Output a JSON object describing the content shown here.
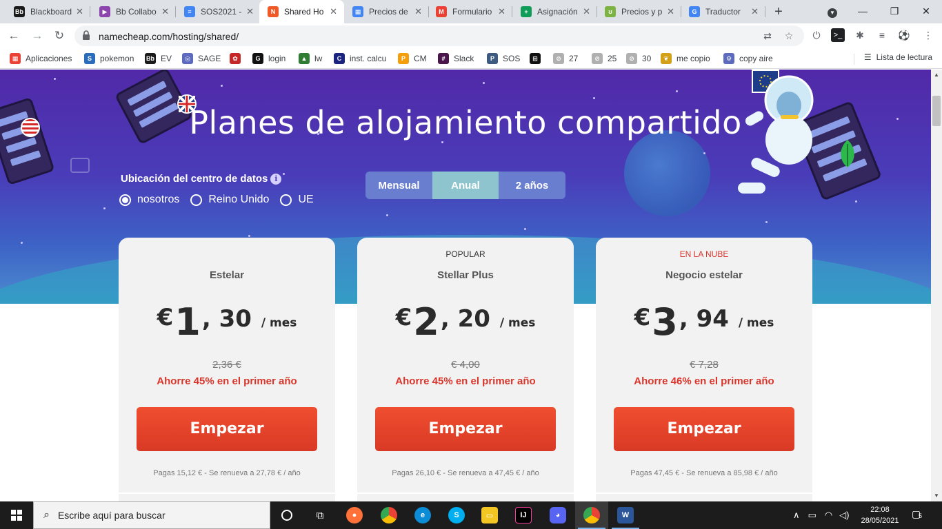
{
  "browser": {
    "tabs": [
      {
        "label": "Blackboard",
        "icon": "Bb",
        "color": "#1a1a1a"
      },
      {
        "label": "Bb Collabo",
        "icon": "▶",
        "color": "#8e44ad"
      },
      {
        "label": "SOS2021 -",
        "icon": "≡",
        "color": "#4285f4"
      },
      {
        "label": "Shared Ho",
        "icon": "N",
        "color": "#f05a28"
      },
      {
        "label": "Precios de",
        "icon": "▦",
        "color": "#4285f4"
      },
      {
        "label": "Formulario",
        "icon": "M",
        "color": "#ea4335"
      },
      {
        "label": "Asignación",
        "icon": "+",
        "color": "#0f9d58"
      },
      {
        "label": "Precios y p",
        "icon": "ʊ",
        "color": "#7cb342"
      },
      {
        "label": "Traductor",
        "icon": "G",
        "color": "#4285f4"
      }
    ],
    "active_tab": 3,
    "url": "namecheap.com/hosting/shared/",
    "bookmarks": [
      {
        "label": "Aplicaciones",
        "icon": "▦",
        "color": "#ea4335"
      },
      {
        "label": "pokemon",
        "icon": "S",
        "color": "#2a6ebb"
      },
      {
        "label": "EV",
        "icon": "Bb",
        "color": "#1a1a1a"
      },
      {
        "label": "SAGE",
        "icon": "◎",
        "color": "#5c6bc0"
      },
      {
        "label": "",
        "icon": "✿",
        "color": "#c62828"
      },
      {
        "label": "login",
        "icon": "G",
        "color": "#111"
      },
      {
        "label": "lw",
        "icon": "▲",
        "color": "#2e7d32"
      },
      {
        "label": "inst. calcu",
        "icon": "C",
        "color": "#1a237e"
      },
      {
        "label": "CM",
        "icon": "P",
        "color": "#f59e0b"
      },
      {
        "label": "Slack",
        "icon": "#",
        "color": "#4a154b"
      },
      {
        "label": "SOS",
        "icon": "P",
        "color": "#3d5a80"
      },
      {
        "label": "",
        "icon": "⊞",
        "color": "#111"
      },
      {
        "label": "27",
        "icon": "⊘",
        "color": "#b0b0b0"
      },
      {
        "label": "25",
        "icon": "⊘",
        "color": "#b0b0b0"
      },
      {
        "label": "30",
        "icon": "⊘",
        "color": "#b0b0b0"
      },
      {
        "label": "me copio",
        "icon": "❦",
        "color": "#d4a017"
      },
      {
        "label": "copy aire",
        "icon": "⚙",
        "color": "#5c6bc0"
      }
    ],
    "reading_list": "Lista de lectura"
  },
  "hero": {
    "title": "Planes de alojamiento compartido",
    "datacenter_label": "Ubicación del centro de datos",
    "info_icon": "i",
    "locations": [
      "nosotros",
      "Reino Unido",
      "UE"
    ],
    "selected_location": 0,
    "billing_options": [
      "Mensual",
      "Anual",
      "2 años"
    ],
    "selected_billing": 1
  },
  "plans": [
    {
      "badge": "",
      "name": "Estelar",
      "currency": "€",
      "int": "1",
      "dec": ", 30",
      "per": "/ mes",
      "old_price": "2,36 €",
      "save": "Ahorre 45% en el primer año",
      "cta": "Empezar",
      "renew": "Pagas 15,12 € - Se renueva a 27,78 € / año",
      "badge_color": ""
    },
    {
      "badge": "POPULAR",
      "name": "Stellar Plus",
      "currency": "€",
      "int": "2",
      "dec": ", 20",
      "per": "/ mes",
      "old_price": "€ 4,00",
      "save": "Ahorre 45% en el primer año",
      "cta": "Empezar",
      "renew": "Pagas 26,10 € - Se renueva a 47,45 € / año",
      "badge_color": "#333333"
    },
    {
      "badge": "EN LA NUBE",
      "name": "Negocio estelar",
      "currency": "€",
      "int": "3",
      "dec": ", 94",
      "per": "/ mes",
      "old_price": "€ 7,28",
      "save": "Ahorre 46% en el primer año",
      "cta": "Empezar",
      "renew": "Pagas 47,45 € - Se renueva a 85,98 € / año",
      "badge_color": "#d9352b"
    }
  ],
  "taskbar": {
    "search_placeholder": "Escribe aquí para buscar",
    "time": "22:08",
    "date": "28/05/2021",
    "notifications": "5"
  },
  "colors": {
    "accent": "#e8432b",
    "hero_top": "#5129a8",
    "billing_active": "#8ec4cd"
  }
}
